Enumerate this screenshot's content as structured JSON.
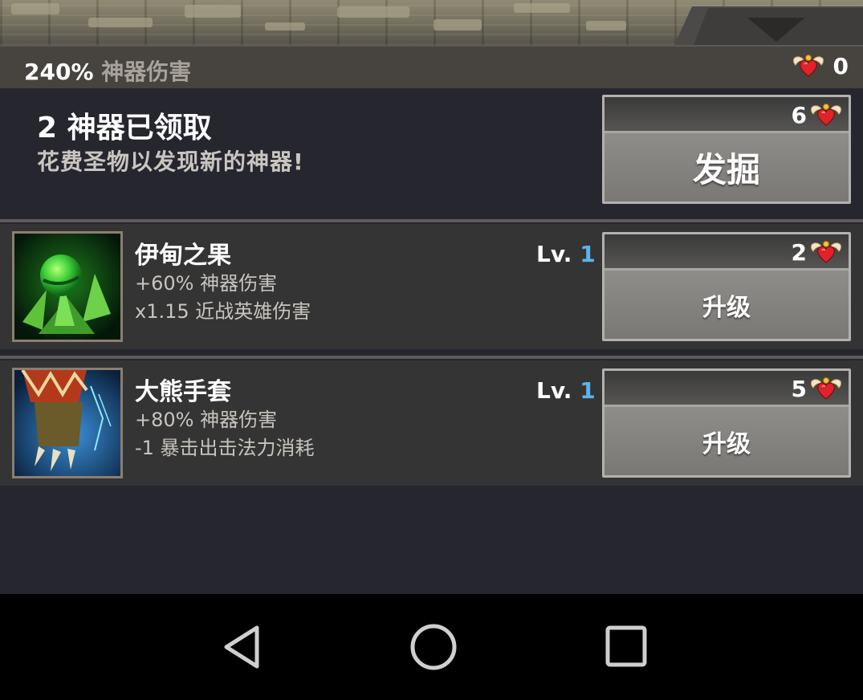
{
  "header": {
    "bonus_value": "240%",
    "bonus_label": "神器伤害",
    "relic_count": "0"
  },
  "dig": {
    "title": "2 神器已领取",
    "subtitle": "花费圣物以发现新的神器!",
    "cost": "6",
    "button_label": "发掘"
  },
  "artifacts": [
    {
      "name": "伊甸之果",
      "effect1": "+60% 神器伤害",
      "effect2": "x1.15 近战英雄伤害",
      "level_prefix": "Lv.",
      "level": "1",
      "cost": "2",
      "button_label": "升级"
    },
    {
      "name": "大熊手套",
      "effect1": "+80% 神器伤害",
      "effect2": "-1 暴击出击法力消耗",
      "level_prefix": "Lv.",
      "level": "1",
      "cost": "5",
      "button_label": "升级"
    }
  ],
  "colors": {
    "panel_bg": "#26262f",
    "row_bg": "#343434",
    "level_accent": "#5ab4ea",
    "button_gray": "#858380"
  },
  "icons": {
    "relic": "winged-heart-icon",
    "collapse": "triangle-down-icon",
    "nav_back": "back-triangle-icon",
    "nav_home": "home-circle-icon",
    "nav_recents": "recents-square-icon"
  }
}
